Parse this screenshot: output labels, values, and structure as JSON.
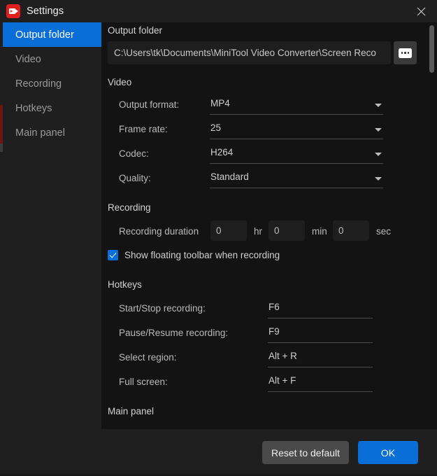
{
  "window": {
    "title": "Settings",
    "app_icon": "video-camera-icon",
    "close_icon": "close-icon"
  },
  "colors": {
    "accent": "#0a6ed8",
    "app_icon_red": "#e02020",
    "panel_bg": "#131313",
    "window_bg": "#1f1f1f",
    "underline": "#4a4a4a"
  },
  "sidebar": {
    "items": [
      {
        "label": "Output folder",
        "active": true
      },
      {
        "label": "Video",
        "active": false
      },
      {
        "label": "Recording",
        "active": false
      },
      {
        "label": "Hotkeys",
        "active": false
      },
      {
        "label": "Main panel",
        "active": false
      }
    ]
  },
  "output_folder": {
    "heading": "Output folder",
    "path_value": "C:\\Users\\tk\\Documents\\MiniTool Video Converter\\Screen Reco",
    "path_placeholder": "Output folder path",
    "browse_icon": "ellipsis-icon"
  },
  "video": {
    "heading": "Video",
    "fields": [
      {
        "label": "Output format:",
        "value": "MP4"
      },
      {
        "label": "Frame rate:",
        "value": "25"
      },
      {
        "label": "Codec:",
        "value": "H264"
      },
      {
        "label": "Quality:",
        "value": "Standard"
      }
    ]
  },
  "recording": {
    "heading": "Recording",
    "duration_label": "Recording duration",
    "hours": "0",
    "hours_unit": "hr",
    "minutes": "0",
    "minutes_unit": "min",
    "seconds": "0",
    "seconds_unit": "sec",
    "floating_toolbar_label": "Show floating toolbar when recording",
    "floating_toolbar_checked": true
  },
  "hotkeys": {
    "heading": "Hotkeys",
    "fields": [
      {
        "label": "Start/Stop recording:",
        "value": "F6"
      },
      {
        "label": "Pause/Resume recording:",
        "value": "F9"
      },
      {
        "label": "Select region:",
        "value": "Alt + R"
      },
      {
        "label": "Full screen:",
        "value": "Alt + F"
      }
    ]
  },
  "main_panel": {
    "heading": "Main panel"
  },
  "footer": {
    "reset_label": "Reset to default",
    "ok_label": "OK"
  }
}
